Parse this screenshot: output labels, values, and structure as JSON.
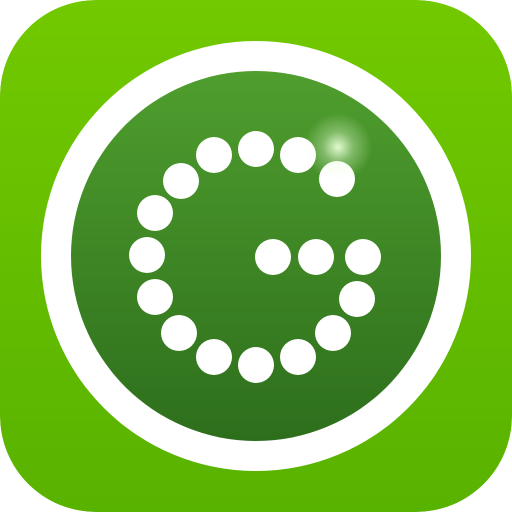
{
  "app_icon": {
    "icon": "dotted-letter-g-logo",
    "colors": {
      "tile_top": "#72c900",
      "tile_bottom": "#58b200",
      "ring": "#ffffff",
      "disc_top": "#4f9e2e",
      "disc_bottom": "#2d6e1c",
      "dots": "#ffffff",
      "glare": "#e8ffd8"
    }
  }
}
